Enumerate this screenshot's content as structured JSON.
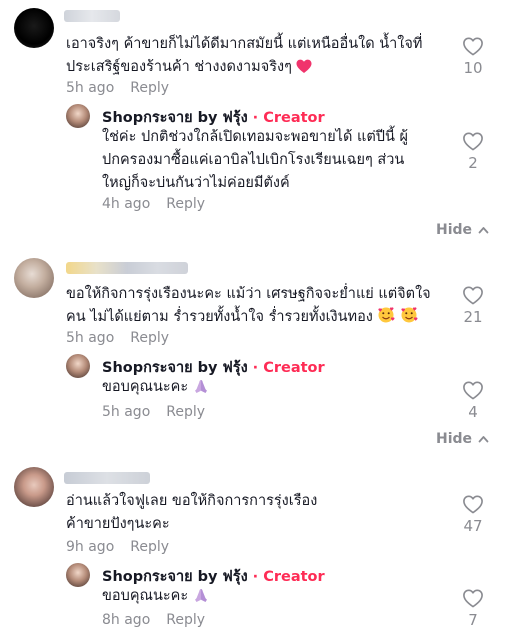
{
  "comments": [
    {
      "text_line1": "เอาจริงๆ ค้าขายก็ไม่ได้ดีมากสมัยนี้ แต่เหนืออื่นใด น้ำใจที่",
      "text_line2": "ประเสริฐ์ของร้านค้า ช่างงดงามจริงๆ",
      "time": "5h ago",
      "reply_label": "Reply",
      "likes": "10",
      "reply": {
        "author": "Shopกระจาย by ฟรุ้ง",
        "dot": "·",
        "badge": "Creator",
        "text_line1": "ใช่ค่ะ ปกติช่วงใกล้เปิดเทอมจะพอขายได้ แต่ปีนี้ ผู้",
        "text_line2": "ปกครองมาซื้อแค่เอาบิลไปเบิกโรงเรียนเฉยๆ ส่วน",
        "text_line3": "ใหญ่ก็จะบ่นกันว่าไม่ค่อยมีตังค์",
        "time": "4h ago",
        "reply_label": "Reply",
        "likes": "2"
      },
      "hide_label": "Hide"
    },
    {
      "text_line1": "ขอให้กิจการรุ่งเรืองนะคะ แม้ว่า เศรษฐกิจจะย่ำแย่ แต่จิตใจ",
      "text_line2": "คน ไม่ได้แย่ตาม ร่ำรวยทั้งน้ำใจ ร่ำรวยทั้งเงินทอง",
      "time": "5h ago",
      "reply_label": "Reply",
      "likes": "21",
      "reply": {
        "author": "Shopกระจาย by ฟรุ้ง",
        "dot": "·",
        "badge": "Creator",
        "text_line1": "ขอบคุณนะคะ",
        "time": "5h ago",
        "reply_label": "Reply",
        "likes": "4"
      },
      "hide_label": "Hide"
    },
    {
      "text_line1": "อ่านแล้วใจฟูเลย ขอให้กิจการการรุ่งเรือง",
      "text_line2": "ค้าขายปังๆนะคะ",
      "time": "9h ago",
      "reply_label": "Reply",
      "likes": "47",
      "reply": {
        "author": "Shopกระจาย by ฟรุ้ง",
        "dot": "·",
        "badge": "Creator",
        "text_line1": "ขอบคุณนะคะ",
        "time": "8h ago",
        "reply_label": "Reply",
        "likes": "7"
      }
    }
  ],
  "icons": {
    "like": "heart-outline-icon",
    "hide": "chevron-up-icon",
    "emoji_heart": "pink-heart-emoji",
    "emoji_smile": "smiling-face-with-hearts-emoji",
    "emoji_pray": "folded-hands-emoji"
  },
  "colors": {
    "creator": "#fe2c55",
    "muted": "#8a8b91",
    "text": "#161823"
  }
}
